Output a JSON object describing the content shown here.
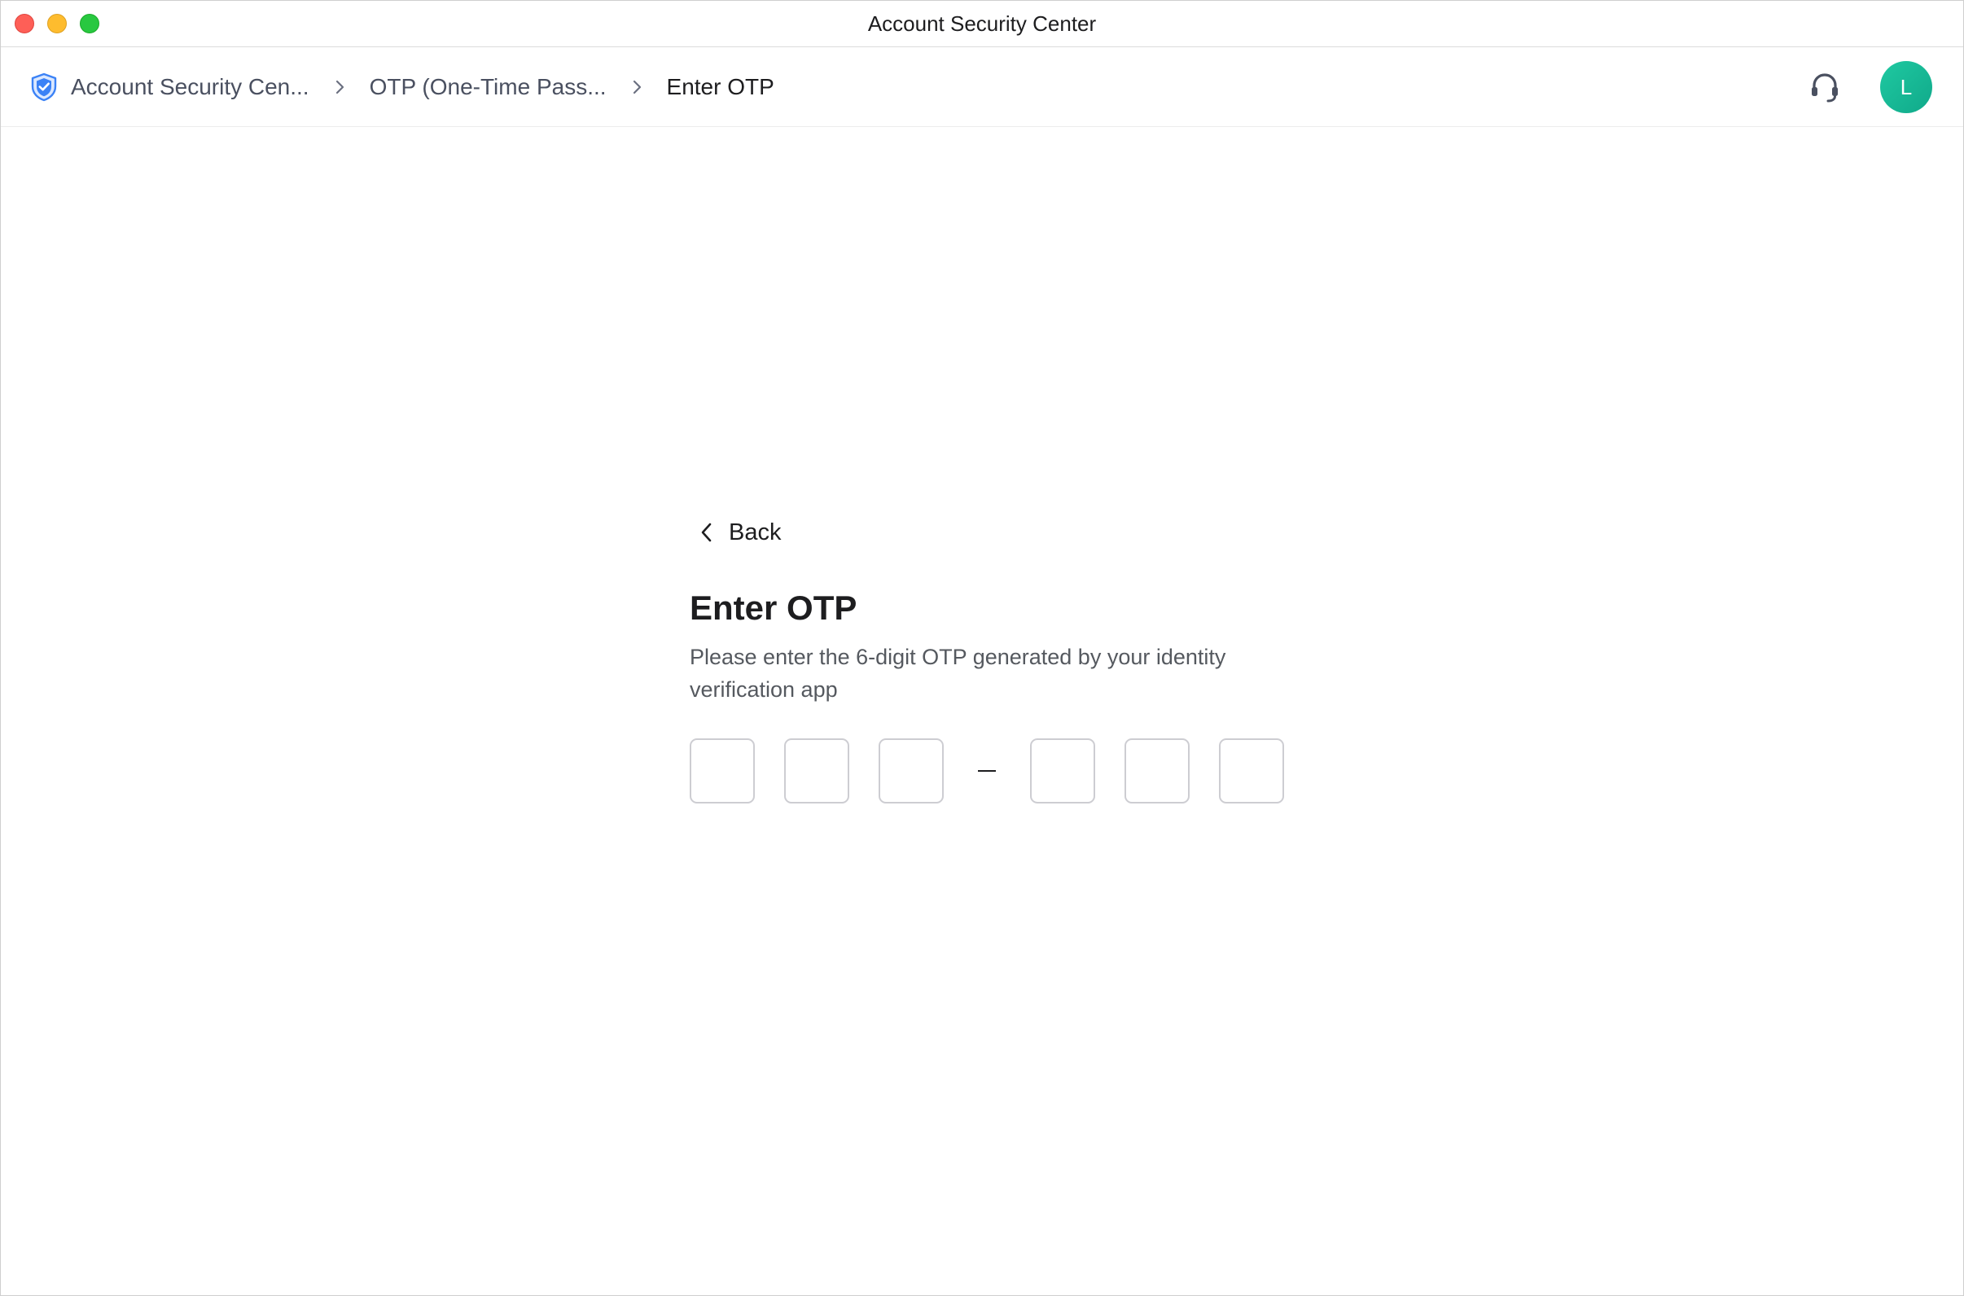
{
  "window": {
    "title": "Account Security Center"
  },
  "breadcrumb": {
    "items": [
      {
        "label": "Account Security Cen..."
      },
      {
        "label": "OTP (One-Time Pass..."
      },
      {
        "label": "Enter OTP"
      }
    ]
  },
  "header": {
    "support_icon": "headset-icon",
    "avatar_initial": "L",
    "avatar_color": "#16b896"
  },
  "main": {
    "back_label": "Back",
    "title": "Enter OTP",
    "description": "Please enter the 6-digit OTP generated by your identity verification app",
    "otp_digits": [
      "",
      "",
      "",
      "",
      "",
      ""
    ]
  },
  "colors": {
    "accent": "#2f6fec",
    "text": "#1d1d1f",
    "muted": "#55595f",
    "border": "#cdcdd2"
  }
}
